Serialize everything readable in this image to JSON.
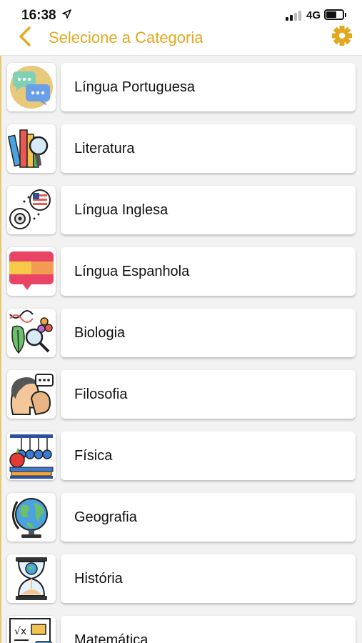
{
  "status_bar": {
    "time": "16:38",
    "network": "4G"
  },
  "nav": {
    "title": "Selecione a Categoria",
    "back_icon": "chevron-left-icon",
    "settings_icon": "gear-icon"
  },
  "colors": {
    "accent": "#e2a91f",
    "background": "#f2f2f2",
    "card": "#ffffff",
    "text": "#111111"
  },
  "categories": [
    {
      "label": "Língua Portuguesa",
      "icon": "chat-bubbles-icon"
    },
    {
      "label": "Literatura",
      "icon": "books-magnifier-icon"
    },
    {
      "label": "Língua Inglesa",
      "icon": "english-speech-icon"
    },
    {
      "label": "Língua Espanhola",
      "icon": "spain-flag-icon"
    },
    {
      "label": "Biologia",
      "icon": "dna-leaf-icon"
    },
    {
      "label": "Filosofia",
      "icon": "thinking-heads-icon"
    },
    {
      "label": "Física",
      "icon": "newtons-cradle-icon"
    },
    {
      "label": "Geografia",
      "icon": "globe-icon"
    },
    {
      "label": "História",
      "icon": "hourglass-icon"
    },
    {
      "label": "Matemática",
      "icon": "math-board-icon"
    }
  ]
}
